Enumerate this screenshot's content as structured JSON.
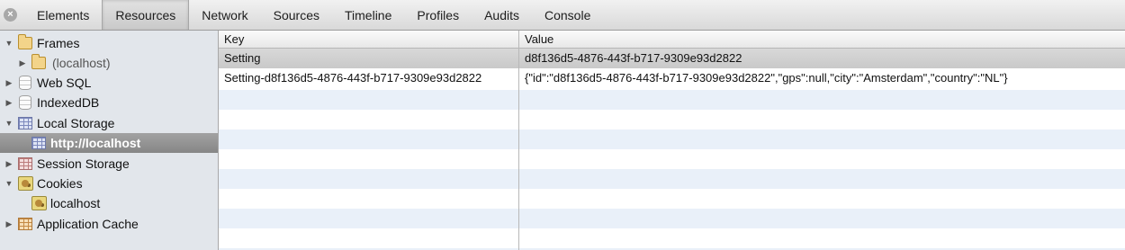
{
  "toolbar": {
    "close_glyph": "×",
    "tabs": [
      {
        "label": "Elements",
        "selected": false
      },
      {
        "label": "Resources",
        "selected": true
      },
      {
        "label": "Network",
        "selected": false
      },
      {
        "label": "Sources",
        "selected": false
      },
      {
        "label": "Timeline",
        "selected": false
      },
      {
        "label": "Profiles",
        "selected": false
      },
      {
        "label": "Audits",
        "selected": false
      },
      {
        "label": "Console",
        "selected": false
      }
    ]
  },
  "sidebar": {
    "items": [
      {
        "label": "Frames",
        "expanded": true,
        "icon": "folder-icon"
      },
      {
        "label": "(localhost)",
        "expanded": false,
        "icon": "folder-icon"
      },
      {
        "label": "Web SQL",
        "expanded": false,
        "icon": "database-icon"
      },
      {
        "label": "IndexedDB",
        "expanded": false,
        "icon": "database-icon"
      },
      {
        "label": "Local Storage",
        "expanded": true,
        "icon": "storage-grid-icon"
      },
      {
        "label": "http://localhost",
        "selected": true,
        "icon": "storage-grid-icon"
      },
      {
        "label": "Session Storage",
        "expanded": false,
        "icon": "session-grid-icon"
      },
      {
        "label": "Cookies",
        "expanded": true,
        "icon": "cookie-icon"
      },
      {
        "label": "localhost",
        "icon": "cookie-icon"
      },
      {
        "label": "Application Cache",
        "expanded": false,
        "icon": "cache-grid-icon"
      }
    ]
  },
  "table": {
    "columns": [
      "Key",
      "Value"
    ],
    "rows": [
      {
        "key": "Setting",
        "value": "d8f136d5-4876-443f-b717-9309e93d2822",
        "selected": true
      },
      {
        "key": "Setting-d8f136d5-4876-443f-b717-9309e93d2822",
        "value": "{\"id\":\"d8f136d5-4876-443f-b717-9309e93d2822\",\"gps\":null,\"city\":\"Amsterdam\",\"country\":\"NL\"}",
        "selected": false
      }
    ]
  }
}
